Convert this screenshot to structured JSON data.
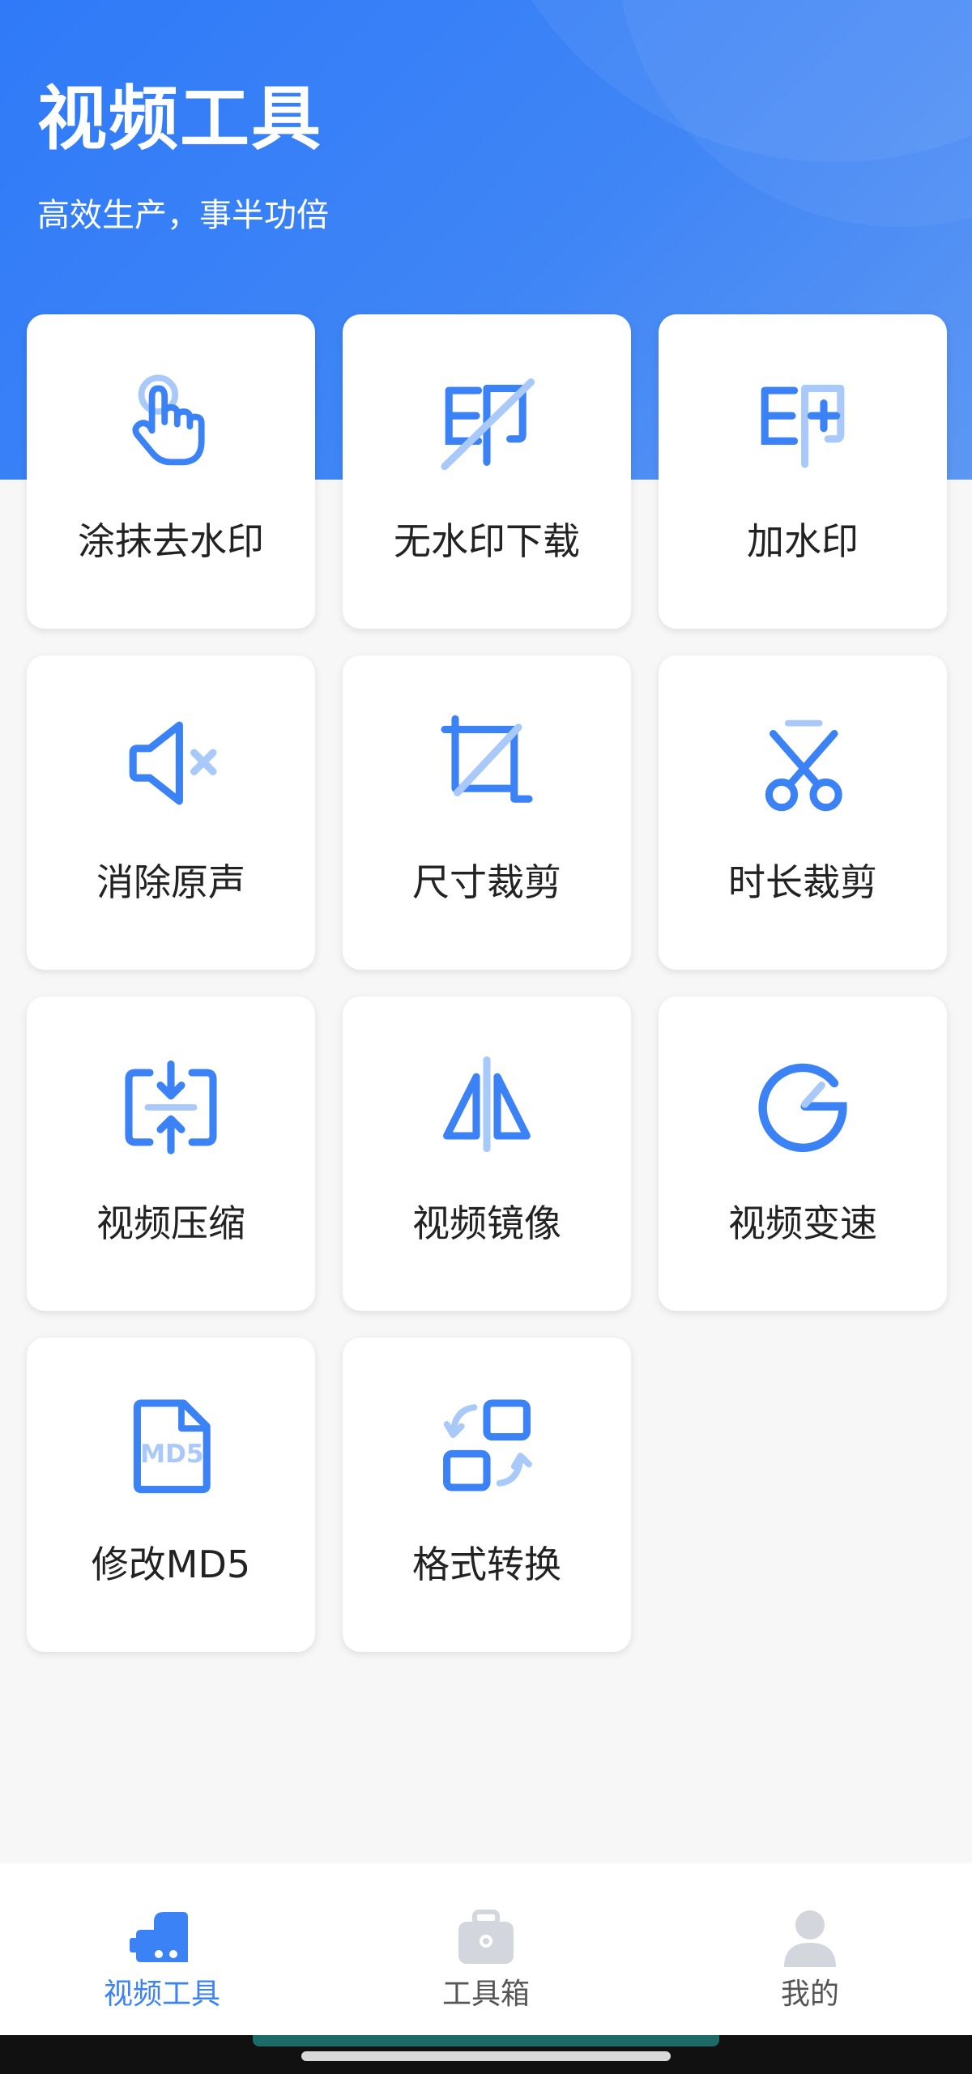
{
  "header": {
    "title": "视频工具",
    "subtitle": "高效生产，事半功倍"
  },
  "tools": [
    {
      "label": "涂抹去水印",
      "icon": "tap-hand-icon"
    },
    {
      "label": "无水印下载",
      "icon": "no-watermark-icon"
    },
    {
      "label": "加水印",
      "icon": "add-watermark-icon"
    },
    {
      "label": "消除原声",
      "icon": "mute-speaker-icon"
    },
    {
      "label": "尺寸裁剪",
      "icon": "crop-icon"
    },
    {
      "label": "时长裁剪",
      "icon": "scissors-icon"
    },
    {
      "label": "视频压缩",
      "icon": "compress-icon"
    },
    {
      "label": "视频镜像",
      "icon": "mirror-icon"
    },
    {
      "label": "视频变速",
      "icon": "speed-gauge-icon"
    },
    {
      "label": "修改MD5",
      "icon": "md5-file-icon",
      "icon_text": "MD5"
    },
    {
      "label": "格式转换",
      "icon": "format-convert-icon"
    }
  ],
  "tabbar": {
    "active": 0,
    "items": [
      {
        "label": "视频工具",
        "icon": "video-camera-icon"
      },
      {
        "label": "工具箱",
        "icon": "toolbox-icon"
      },
      {
        "label": "我的",
        "icon": "user-icon"
      }
    ]
  },
  "colors": {
    "accent": "#3a82f6",
    "accent_light": "#a9c9fb",
    "header_start": "#2f7af8",
    "header_end": "#5d97f3",
    "tab_inactive": "#d3d6dc"
  }
}
